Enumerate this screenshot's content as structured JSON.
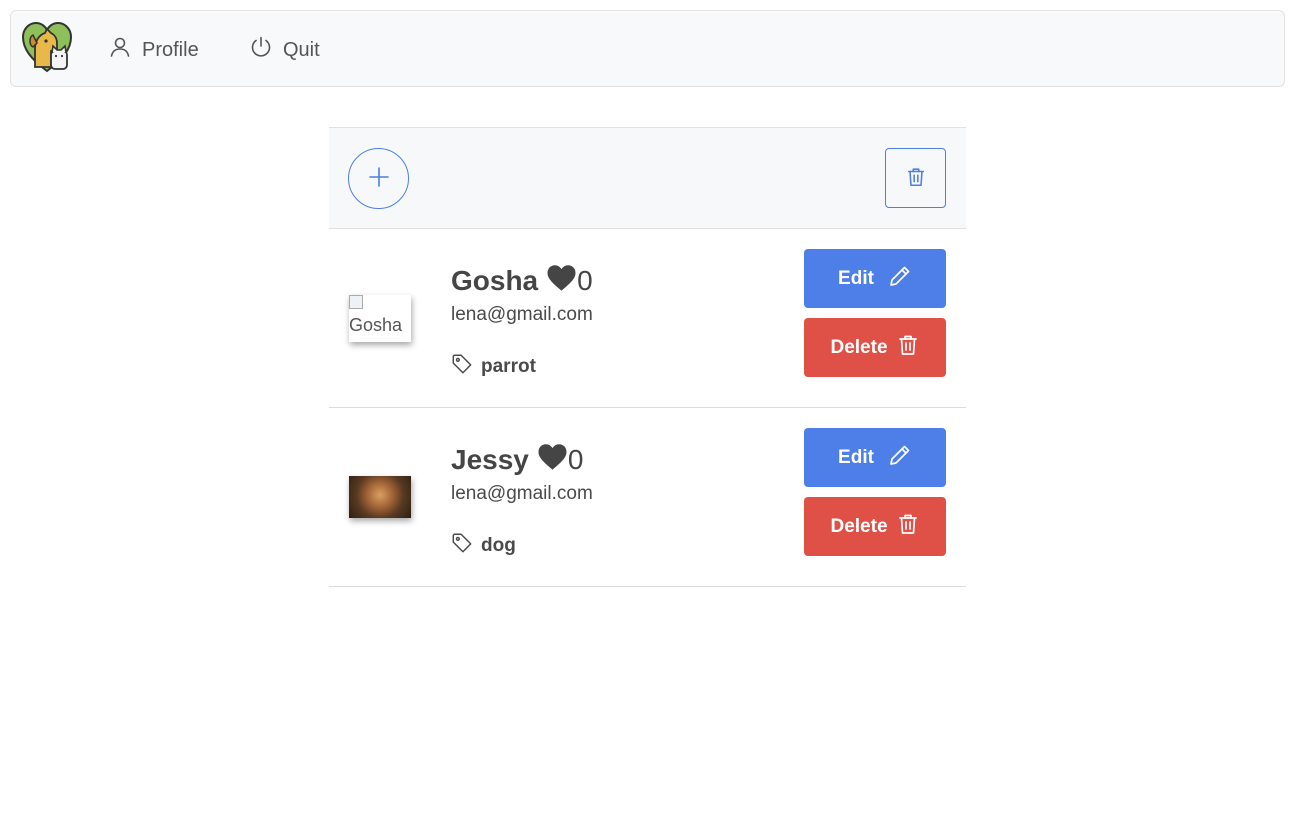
{
  "nav": {
    "profile_label": "Profile",
    "quit_label": "Quit"
  },
  "colors": {
    "primary": "#4e7fe8",
    "danger": "#df5047",
    "navbar_bg": "#f8f9fa"
  },
  "pets": [
    {
      "name": "Gosha",
      "likes": "0",
      "email": "lena@gmail.com",
      "tag": "parrot",
      "image_alt": "Gosha",
      "edit_label": "Edit",
      "delete_label": "Delete"
    },
    {
      "name": "Jessy",
      "likes": "0",
      "email": "lena@gmail.com",
      "tag": "dog",
      "image_alt": "Jessy",
      "edit_label": "Edit",
      "delete_label": "Delete"
    }
  ],
  "icons": {
    "logo": "pets-heart-logo",
    "profile": "user-icon",
    "quit": "power-icon",
    "add": "plus-icon",
    "trash": "trash-icon",
    "heart": "heart-icon",
    "tag": "tag-icon",
    "edit": "pencil-icon"
  }
}
